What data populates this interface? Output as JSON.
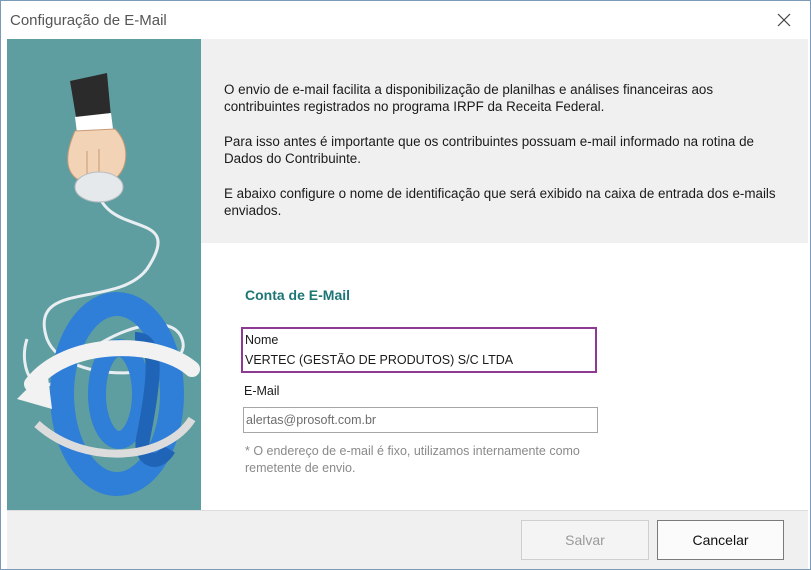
{
  "window": {
    "title": "Configuração de E-Mail",
    "close_icon": "close-icon"
  },
  "illustration": {
    "icon": "email-at-hand-illustration",
    "colors": {
      "panel": "#5f9ea0",
      "at_symbol": "#2f7ed8"
    }
  },
  "intro": {
    "paragraph_1": "O envio de e-mail facilita a disponibilização de planilhas e análises financeiras aos contribuintes registrados no programa IRPF da Receita Federal.",
    "paragraph_2": "Para isso antes é importante que os contribuintes possuam e-mail informado na rotina de Dados do Contribuinte.",
    "paragraph_3": "E abaixo configure o nome de identificação que será exibido na caixa de entrada dos e-mails enviados."
  },
  "form": {
    "section_title": "Conta de E-Mail",
    "nome_label": "Nome",
    "nome_value": "VERTEC (GESTÃO DE PRODUTOS) S/C LTDA",
    "email_label": "E-Mail",
    "email_value": "alertas@prosoft.com.br",
    "note": "* O endereço de e-mail é fixo, utilizamos internamente como remetente de envio."
  },
  "buttons": {
    "save_label": "Salvar",
    "cancel_label": "Cancelar"
  },
  "colors": {
    "accent": "#1e7575",
    "focus_border": "#8e3a93"
  }
}
